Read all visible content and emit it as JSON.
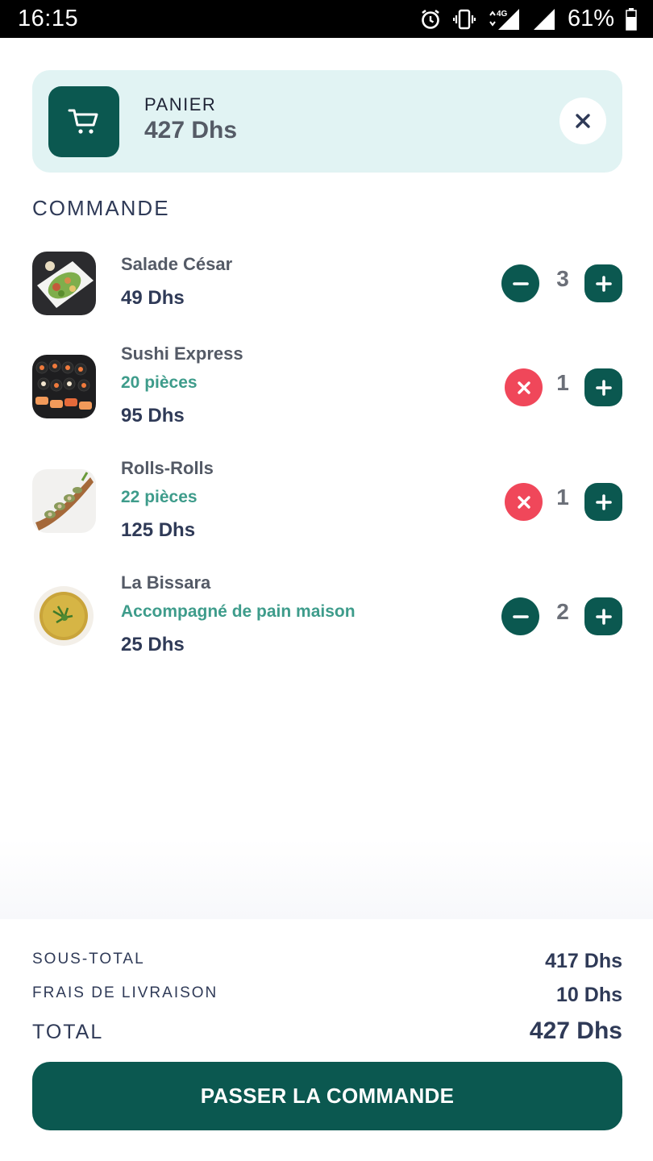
{
  "status_bar": {
    "time": "16:15",
    "network": "4G",
    "battery": "61%",
    "icons": [
      "alarm-icon",
      "vibrate-icon",
      "signal-icon",
      "battery-icon"
    ]
  },
  "cart": {
    "label": "PANIER",
    "total": "427 Dhs",
    "icon": "cart-icon",
    "close_icon": "close-icon"
  },
  "order_section": {
    "title": "COMMANDE"
  },
  "items": [
    {
      "name": "Salade César",
      "subtitle": "",
      "price": "49 Dhs",
      "quantity": "3",
      "decrement": "minus"
    },
    {
      "name": "Sushi Express",
      "subtitle": "20 pièces",
      "price": "95 Dhs",
      "quantity": "1",
      "decrement": "remove"
    },
    {
      "name": "Rolls-Rolls",
      "subtitle": "22 pièces",
      "price": "125 Dhs",
      "quantity": "1",
      "decrement": "remove"
    },
    {
      "name": "La Bissara",
      "subtitle": "Accompagné de pain maison",
      "price": "25 Dhs",
      "quantity": "2",
      "decrement": "minus"
    }
  ],
  "summary": {
    "subtotal_label": "SOUS-TOTAL",
    "subtotal_value": "417 Dhs",
    "delivery_label": "FRAIS DE LIVRAISON",
    "delivery_value": "10 Dhs",
    "total_label": "TOTAL",
    "total_value": "427 Dhs"
  },
  "checkout": {
    "button_label": "PASSER LA COMMANDE"
  },
  "colors": {
    "primary": "#0b5850",
    "danger": "#f0475a",
    "accent_text": "#3e9c8b",
    "header_bg": "#e1f3f3",
    "text_dark": "#2f3a57"
  }
}
